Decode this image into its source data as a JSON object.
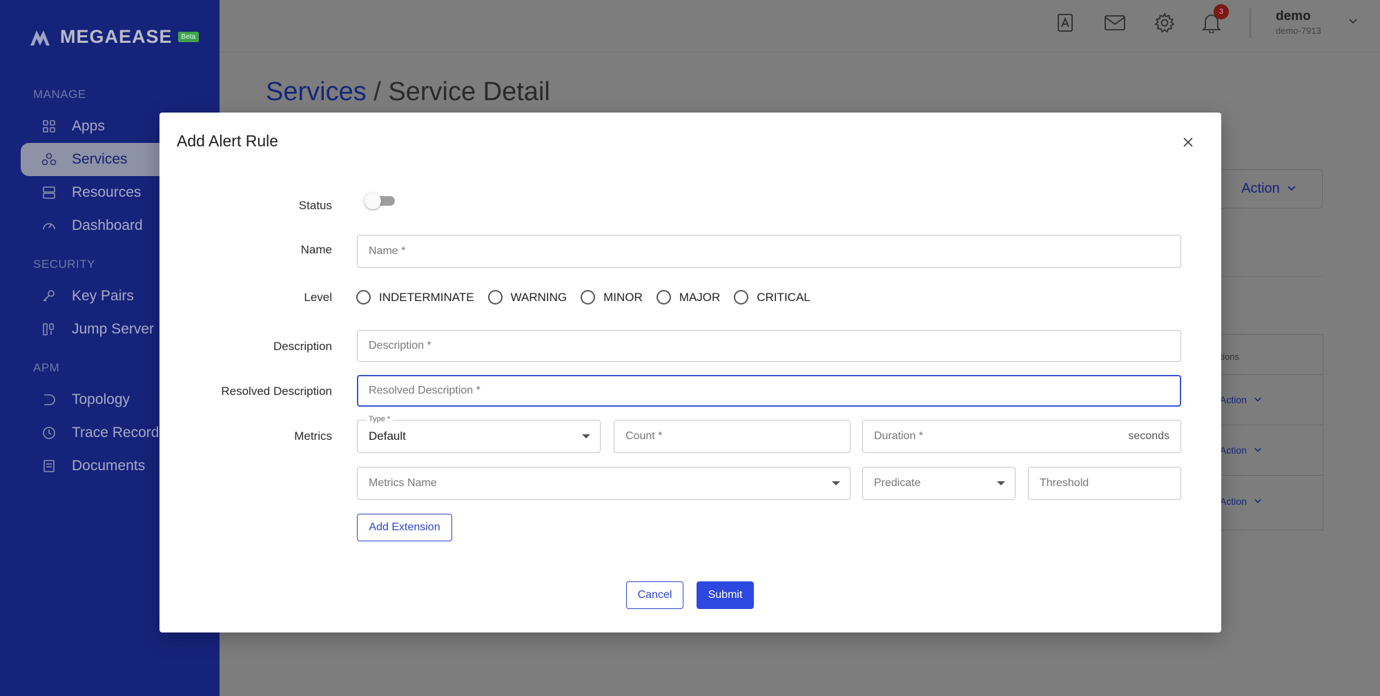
{
  "brand": {
    "name": "MEGAEASE",
    "badge": "Beta"
  },
  "sidebar": {
    "sections": [
      {
        "title": "MANAGE",
        "items": [
          {
            "label": "Apps",
            "icon": "apps-grid-icon"
          },
          {
            "label": "Services",
            "icon": "services-icon",
            "active": true
          },
          {
            "label": "Resources",
            "icon": "resources-icon"
          },
          {
            "label": "Dashboard",
            "icon": "dashboard-gauge-icon"
          }
        ]
      },
      {
        "title": "SECURITY",
        "items": [
          {
            "label": "Key Pairs",
            "icon": "key-icon"
          },
          {
            "label": "Jump Server",
            "icon": "jump-server-icon"
          }
        ]
      },
      {
        "title": "APM",
        "items": [
          {
            "label": "Topology",
            "icon": "topology-icon"
          },
          {
            "label": "Trace Records",
            "icon": "clock-icon"
          },
          {
            "label": "Documents",
            "icon": "document-icon"
          }
        ]
      }
    ]
  },
  "topbar": {
    "icons": [
      "contacts-icon",
      "mail-icon",
      "gear-icon",
      "bell-icon"
    ],
    "notifications_count": "3",
    "user": {
      "name": "demo",
      "id": "demo-7913"
    }
  },
  "page": {
    "breadcrumb_link": "Services",
    "breadcrumb_sep": " / ",
    "breadcrumb_current": "Service Detail",
    "action_label": "Action",
    "table_header": "ctions",
    "table_rows": [
      "Action",
      "Action",
      "Action"
    ]
  },
  "modal": {
    "title": "Add Alert Rule",
    "labels": {
      "status": "Status",
      "name": "Name",
      "level": "Level",
      "description": "Description",
      "resolved_description": "Resolved Description",
      "metrics": "Metrics"
    },
    "status_on": false,
    "placeholders": {
      "name": "Name *",
      "description": "Description *",
      "resolved_description": "Resolved Description *",
      "count": "Count *",
      "duration": "Duration *",
      "metrics_name": "Metrics Name",
      "predicate": "Predicate",
      "threshold": "Threshold"
    },
    "type_label": "Type *",
    "type_value": "Default",
    "duration_suffix": "seconds",
    "levels": [
      "INDETERMINATE",
      "WARNING",
      "MINOR",
      "MAJOR",
      "CRITICAL"
    ],
    "add_extension": "Add Extension",
    "cancel": "Cancel",
    "submit": "Submit"
  },
  "colors": {
    "sidebar_bg": "#16237a",
    "primary": "#2c48e0",
    "focus": "#3a55d6",
    "overlay": "#7d7d7d"
  }
}
